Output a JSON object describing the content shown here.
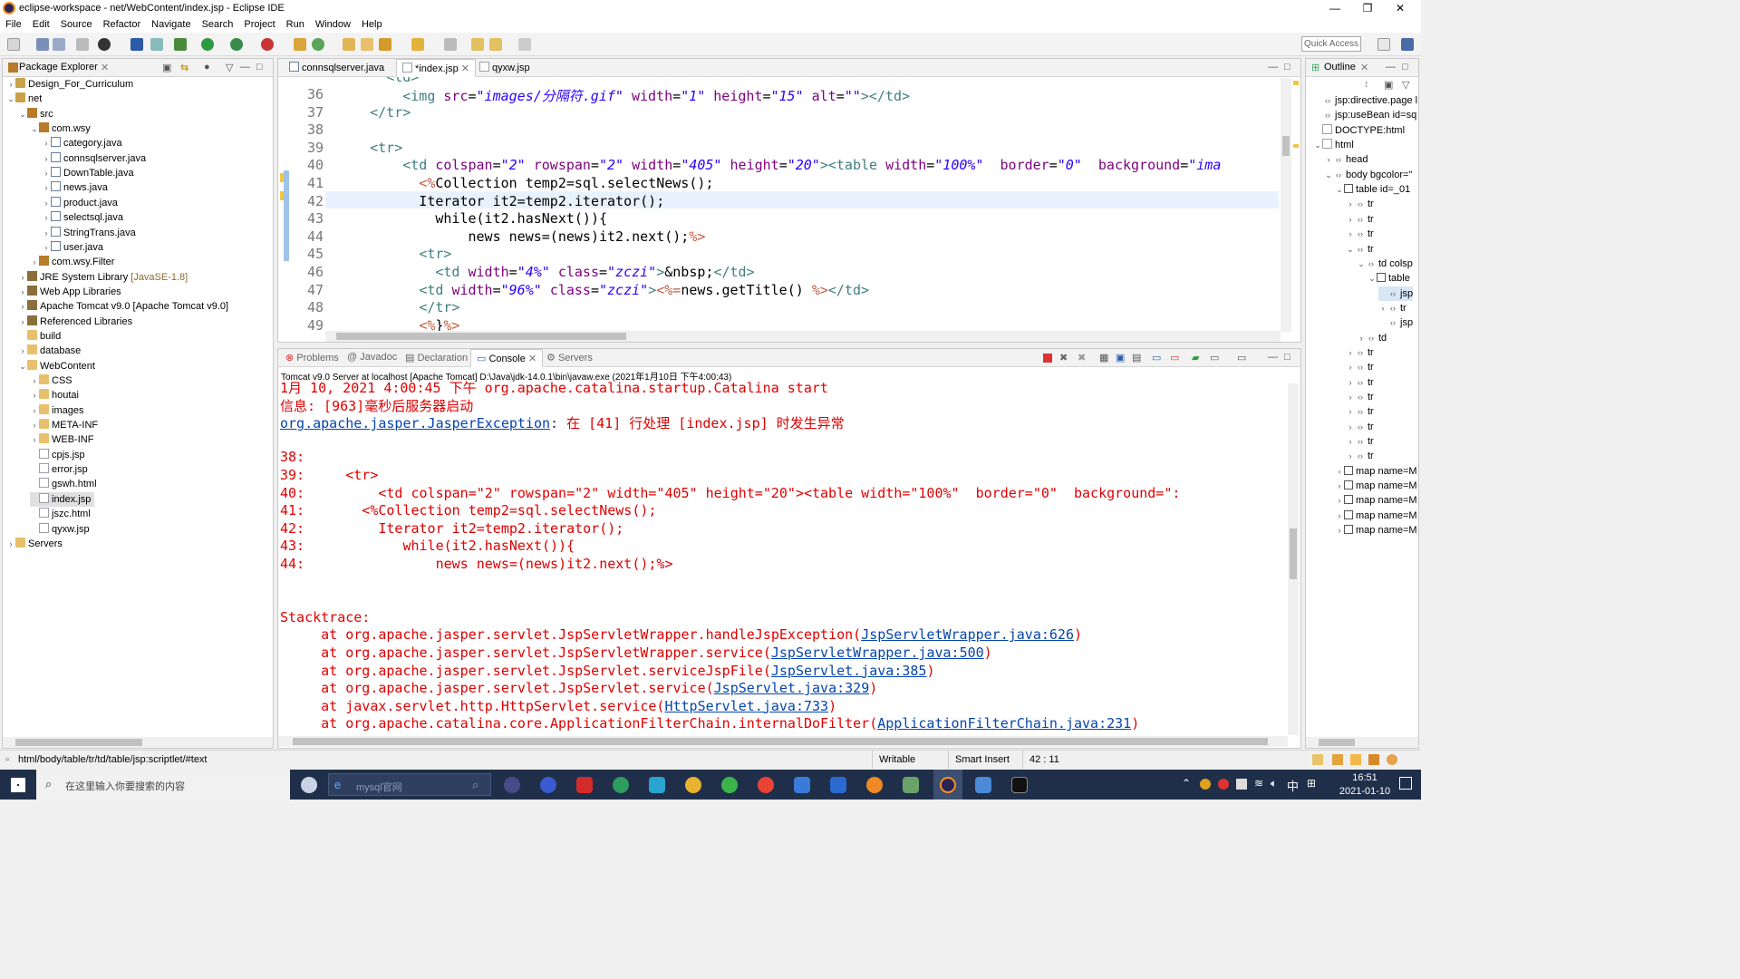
{
  "window": {
    "title": "eclipse-workspace - net/WebContent/index.jsp - Eclipse IDE",
    "min": "—",
    "max": "❐",
    "close": "✕"
  },
  "menu": [
    "File",
    "Edit",
    "Source",
    "Refactor",
    "Navigate",
    "Search",
    "Project",
    "Run",
    "Window",
    "Help"
  ],
  "quick_access": "Quick Access",
  "package_explorer": {
    "title": "Package Explorer",
    "items": [
      {
        "label": "Design_For_Curriculum",
        "depth": 0,
        "icon": "proj",
        "chev": "›"
      },
      {
        "label": "net",
        "depth": 0,
        "icon": "proj",
        "chev": "⌄"
      },
      {
        "label": "src",
        "depth": 1,
        "icon": "pkg",
        "chev": "⌄"
      },
      {
        "label": "com.wsy",
        "depth": 2,
        "icon": "pkg",
        "chev": "⌄"
      },
      {
        "label": "category.java",
        "depth": 3,
        "icon": "java",
        "chev": "›"
      },
      {
        "label": "connsqlserver.java",
        "depth": 3,
        "icon": "java",
        "chev": "›"
      },
      {
        "label": "DownTable.java",
        "depth": 3,
        "icon": "java",
        "chev": "›"
      },
      {
        "label": "news.java",
        "depth": 3,
        "icon": "java",
        "chev": "›"
      },
      {
        "label": "product.java",
        "depth": 3,
        "icon": "java",
        "chev": "›"
      },
      {
        "label": "selectsql.java",
        "depth": 3,
        "icon": "java",
        "chev": "›"
      },
      {
        "label": "StringTrans.java",
        "depth": 3,
        "icon": "java",
        "chev": "›"
      },
      {
        "label": "user.java",
        "depth": 3,
        "icon": "java",
        "chev": "›"
      },
      {
        "label": "com.wsy.Filter",
        "depth": 2,
        "icon": "pkg",
        "chev": "›"
      },
      {
        "label": "JRE System Library",
        "suffix": "[JavaSE-1.8]",
        "depth": 1,
        "icon": "lib",
        "chev": "›"
      },
      {
        "label": "Web App Libraries",
        "depth": 1,
        "icon": "lib",
        "chev": "›"
      },
      {
        "label": "Apache Tomcat v9.0 [Apache Tomcat v9.0]",
        "depth": 1,
        "icon": "lib",
        "chev": "›"
      },
      {
        "label": "Referenced Libraries",
        "depth": 1,
        "icon": "lib",
        "chev": "›"
      },
      {
        "label": "build",
        "depth": 1,
        "icon": "folder",
        "chev": ""
      },
      {
        "label": "database",
        "depth": 1,
        "icon": "folder",
        "chev": "›"
      },
      {
        "label": "WebContent",
        "depth": 1,
        "icon": "folder",
        "chev": "⌄"
      },
      {
        "label": "CSS",
        "depth": 2,
        "icon": "folder",
        "chev": "›"
      },
      {
        "label": "houtai",
        "depth": 2,
        "icon": "folder",
        "chev": "›"
      },
      {
        "label": "images",
        "depth": 2,
        "icon": "folder",
        "chev": "›"
      },
      {
        "label": "META-INF",
        "depth": 2,
        "icon": "folder",
        "chev": "›"
      },
      {
        "label": "WEB-INF",
        "depth": 2,
        "icon": "folder",
        "chev": "›"
      },
      {
        "label": "cpjs.jsp",
        "depth": 2,
        "icon": "file",
        "chev": ""
      },
      {
        "label": "error.jsp",
        "depth": 2,
        "icon": "file",
        "chev": ""
      },
      {
        "label": "gswh.html",
        "depth": 2,
        "icon": "file",
        "chev": ""
      },
      {
        "label": "index.jsp",
        "depth": 2,
        "icon": "file",
        "chev": "",
        "selected": true
      },
      {
        "label": "jszc.html",
        "depth": 2,
        "icon": "file",
        "chev": ""
      },
      {
        "label": "qyxw.jsp",
        "depth": 2,
        "icon": "file",
        "chev": ""
      },
      {
        "label": "Servers",
        "depth": 0,
        "icon": "folder",
        "chev": "›"
      }
    ]
  },
  "editor": {
    "tabs": [
      {
        "label": "connsqlserver.java",
        "active": false
      },
      {
        "label": "*index.jsp",
        "active": true
      },
      {
        "label": "qyxw.jsp",
        "active": false
      }
    ],
    "lines": [
      {
        "n": "36",
        "html": "        <span class='kw'>&lt;img</span> <span class='at'>src</span>=<span class='st'>\"images/分隔符.gif\"</span> <span class='at'>width</span>=<span class='st'>\"1\"</span> <span class='at'>height</span>=<span class='st'>\"15\"</span> <span class='at'>alt</span>=<span class='st'>\"\"</span><span class='kw'>&gt;&lt;/td&gt;</span>"
      },
      {
        "n": "37",
        "html": "    <span class='kw'>&lt;/tr&gt;</span>"
      },
      {
        "n": "38",
        "html": ""
      },
      {
        "n": "39",
        "html": "    <span class='kw'>&lt;tr&gt;</span>"
      },
      {
        "n": "40",
        "html": "        <span class='kw'>&lt;td</span> <span class='at'>colspan</span>=<span class='st'>\"2\"</span> <span class='at'>rowspan</span>=<span class='st'>\"2\"</span> <span class='at'>width</span>=<span class='st'>\"405\"</span> <span class='at'>height</span>=<span class='st'>\"20\"</span><span class='kw'>&gt;&lt;table</span> <span class='at'>width</span>=<span class='st'>\"100%\"</span>  <span class='at'>border</span>=<span class='st'>\"0\"</span>  <span class='at'>background</span>=<span class='st'>\"ima</span>"
      },
      {
        "n": "41",
        "html": "          <span class='sc'>&lt;%</span>Collection temp2=sql.selectNews();"
      },
      {
        "n": "42",
        "html": "          Iterator it2=temp2.iterator();"
      },
      {
        "n": "43",
        "html": "            while(it2.hasNext()){"
      },
      {
        "n": "44",
        "html": "                news news=(news)it2.next();<span class='sc'>%&gt;</span>"
      },
      {
        "n": "45",
        "html": "          <span class='kw'>&lt;tr&gt;</span>"
      },
      {
        "n": "46",
        "html": "            <span class='kw'>&lt;td</span> <span class='at'>width</span>=<span class='st'>\"4%\"</span> <span class='at'>class</span>=<span class='st'>\"zczi\"</span><span class='kw'>&gt;</span>&amp;nbsp;<span class='kw'>&lt;/td&gt;</span>"
      },
      {
        "n": "47",
        "html": "          <span class='kw'>&lt;td</span> <span class='at'>width</span>=<span class='st'>\"96%\"</span> <span class='at'>class</span>=<span class='st'>\"zczi\"</span><span class='kw'>&gt;</span><span class='sc'>&lt;%=</span>news.getTitle() <span class='sc'>%&gt;</span><span class='kw'>&lt;/td&gt;</span>"
      },
      {
        "n": "48",
        "html": "          <span class='kw'>&lt;/tr&gt;</span>"
      },
      {
        "n": "49",
        "html": "          <span class='sc'>&lt;%</span>}<span class='sc'>%&gt;</span>"
      }
    ]
  },
  "outline": {
    "title": "Outline",
    "items": [
      {
        "label": "jsp:directive.page l",
        "depth": 0,
        "icon": "tag",
        "chev": ""
      },
      {
        "label": "jsp:useBean id=sq",
        "depth": 0,
        "icon": "tag",
        "chev": ""
      },
      {
        "label": "DOCTYPE:html",
        "depth": 0,
        "icon": "file",
        "chev": ""
      },
      {
        "label": "html",
        "depth": 0,
        "icon": "file",
        "chev": "⌄"
      },
      {
        "label": "head",
        "depth": 1,
        "icon": "tag",
        "chev": "›"
      },
      {
        "label": "body bgcolor=\"",
        "depth": 1,
        "icon": "tag",
        "chev": "⌄"
      },
      {
        "label": "table id=_01",
        "depth": 2,
        "icon": "tbl",
        "chev": "⌄"
      },
      {
        "label": "tr",
        "depth": 3,
        "icon": "tag",
        "chev": "›"
      },
      {
        "label": "tr",
        "depth": 3,
        "icon": "tag",
        "chev": "›"
      },
      {
        "label": "tr",
        "depth": 3,
        "icon": "tag",
        "chev": "›"
      },
      {
        "label": "tr",
        "depth": 3,
        "icon": "tag",
        "chev": "⌄"
      },
      {
        "label": "td colsp",
        "depth": 4,
        "icon": "tag",
        "chev": "⌄"
      },
      {
        "label": "table",
        "depth": 5,
        "icon": "tbl",
        "chev": "⌄"
      },
      {
        "label": "jsp",
        "depth": 6,
        "icon": "tag",
        "chev": "",
        "selected": true
      },
      {
        "label": "tr",
        "depth": 6,
        "icon": "tag",
        "chev": "›"
      },
      {
        "label": "jsp",
        "depth": 6,
        "icon": "tag",
        "chev": ""
      },
      {
        "label": "td",
        "depth": 4,
        "icon": "tag",
        "chev": "›"
      },
      {
        "label": "tr",
        "depth": 3,
        "icon": "tag",
        "chev": "›"
      },
      {
        "label": "tr",
        "depth": 3,
        "icon": "tag",
        "chev": "›"
      },
      {
        "label": "tr",
        "depth": 3,
        "icon": "tag",
        "chev": "›"
      },
      {
        "label": "tr",
        "depth": 3,
        "icon": "tag",
        "chev": "›"
      },
      {
        "label": "tr",
        "depth": 3,
        "icon": "tag",
        "chev": "›"
      },
      {
        "label": "tr",
        "depth": 3,
        "icon": "tag",
        "chev": "›"
      },
      {
        "label": "tr",
        "depth": 3,
        "icon": "tag",
        "chev": "›"
      },
      {
        "label": "tr",
        "depth": 3,
        "icon": "tag",
        "chev": "›"
      },
      {
        "label": "map name=M",
        "depth": 2,
        "icon": "tbl",
        "chev": "›"
      },
      {
        "label": "map name=M",
        "depth": 2,
        "icon": "tbl",
        "chev": "›"
      },
      {
        "label": "map name=M",
        "depth": 2,
        "icon": "tbl",
        "chev": "›"
      },
      {
        "label": "map name=M",
        "depth": 2,
        "icon": "tbl",
        "chev": "›"
      },
      {
        "label": "map name=M",
        "depth": 2,
        "icon": "tbl",
        "chev": "›"
      }
    ]
  },
  "bottom": {
    "tabs": [
      {
        "label": "Problems",
        "active": false
      },
      {
        "label": "Javadoc",
        "active": false
      },
      {
        "label": "Declaration",
        "active": false
      },
      {
        "label": "Console",
        "active": true
      },
      {
        "label": "Servers",
        "active": false
      }
    ],
    "console_header": "Tomcat v9.0 Server at localhost [Apache Tomcat] D:\\Java\\jdk-14.0.1\\bin\\javaw.exe (2021年1月10日 下午4:00:43)",
    "lines": [
      {
        "html": "1月 10, 2021 4:00:45 下午 org.apache.catalina.startup.Catalina start"
      },
      {
        "html": "信息: [963]毫秒后服务器启动"
      },
      {
        "html": "<span class='lnk'>org.apache.jasper.JasperException</span><span style='color:#333'>:</span> 在 [41] 行处理 [index.jsp] 时发生异常"
      },
      {
        "html": ""
      },
      {
        "html": "38:"
      },
      {
        "html": "39:     &lt;tr&gt;"
      },
      {
        "html": "40:         &lt;td colspan=\"2\" rowspan=\"2\" width=\"405\" height=\"20\"&gt;&lt;table width=\"100%\"  border=\"0\"  background=\":"
      },
      {
        "html": "41:       &lt;%Collection temp2=sql.selectNews();"
      },
      {
        "html": "42:         Iterator it2=temp2.iterator();"
      },
      {
        "html": "43:            while(it2.hasNext()){"
      },
      {
        "html": "44:                news news=(news)it2.next();%&gt;"
      },
      {
        "html": ""
      },
      {
        "html": ""
      },
      {
        "html": "Stacktrace:"
      },
      {
        "html": "     at org.apache.jasper.servlet.JspServletWrapper.handleJspException(<span class='lnk'>JspServletWrapper.java:626</span>)"
      },
      {
        "html": "     at org.apache.jasper.servlet.JspServletWrapper.service(<span class='lnk'>JspServletWrapper.java:500</span>)"
      },
      {
        "html": "     at org.apache.jasper.servlet.JspServlet.serviceJspFile(<span class='lnk'>JspServlet.java:385</span>)"
      },
      {
        "html": "     at org.apache.jasper.servlet.JspServlet.service(<span class='lnk'>JspServlet.java:329</span>)"
      },
      {
        "html": "     at javax.servlet.http.HttpServlet.service(<span class='lnk'>HttpServlet.java:733</span>)"
      },
      {
        "html": "     at org.apache.catalina.core.ApplicationFilterChain.internalDoFilter(<span class='lnk'>ApplicationFilterChain.java:231</span>)"
      }
    ]
  },
  "status": {
    "path": "html/body/table/tr/td/table/jsp:scriptlet/#text",
    "writable": "Writable",
    "insert": "Smart Insert",
    "pos": "42 : 11"
  },
  "taskbar": {
    "search_placeholder": "在这里输入你要搜索的内容",
    "task_search": "mysql官网",
    "time": "16:51",
    "date": "2021-01-10",
    "ime": "中"
  },
  "colors": {
    "console_text": "#e00000",
    "link": "#0645ad",
    "taskbar_bg": "#1f2f4a"
  }
}
